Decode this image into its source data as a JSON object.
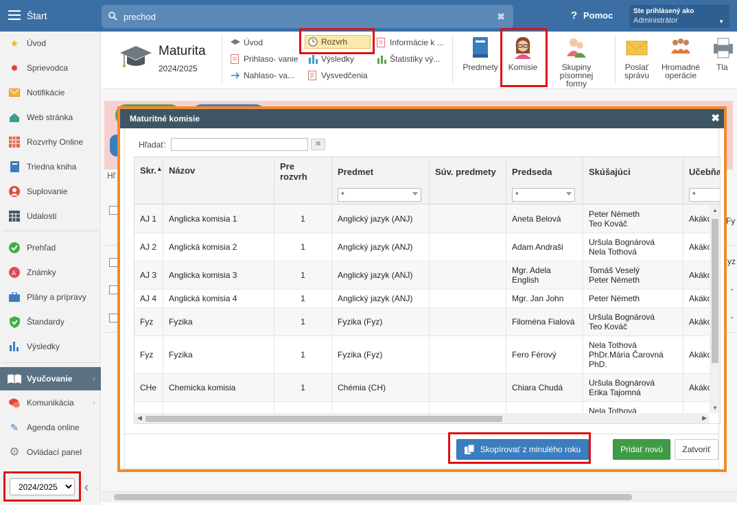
{
  "topbar": {
    "app_title": "Štart",
    "search_value": "prechod",
    "help_label": "Pomoc",
    "user_line1": "Ste prihlásený ako",
    "user_line2": "Administrátor"
  },
  "sidebar": {
    "items": [
      {
        "label": "Úvod",
        "icon": "star-icon"
      },
      {
        "label": "Sprievodca",
        "icon": "wand-icon"
      },
      {
        "label": "Notifikácie",
        "icon": "envelope-icon"
      },
      {
        "label": "Web stránka",
        "icon": "home-icon"
      },
      {
        "label": "Rozvrhy Online",
        "icon": "timetable-icon"
      },
      {
        "label": "Triedna kniha",
        "icon": "book-icon"
      },
      {
        "label": "Suplovanie",
        "icon": "person-icon"
      },
      {
        "label": "Udalosti",
        "icon": "calendar-icon"
      },
      {
        "label": "Prehľad",
        "icon": "check-circle-icon"
      },
      {
        "label": "Známky",
        "icon": "grades-icon"
      },
      {
        "label": "Plány a prípravy",
        "icon": "briefcase-icon"
      },
      {
        "label": "Štandardy",
        "icon": "shield-check-icon"
      },
      {
        "label": "Výsledky",
        "icon": "bar-chart-icon"
      },
      {
        "label": "Vyučovanie",
        "icon": "open-book-icon"
      },
      {
        "label": "Komunikácia",
        "icon": "chat-icon"
      },
      {
        "label": "Agenda online",
        "icon": "pen-icon"
      },
      {
        "label": "Ovládací panel",
        "icon": "gear-icon"
      }
    ],
    "year": "2024/2025"
  },
  "module": {
    "title": "Maturita",
    "year": "2024/2025"
  },
  "ribbon": {
    "uvod": "Úvod",
    "prihlasovanie": "Prihlaso- vanie",
    "nahlasovanie": "Nahlaso- va...",
    "rozvrh": "Rozvrh",
    "vysledky": "Výsledky",
    "vysvedcenia": "Vysvedčenia",
    "informacie": "Informácie k ...",
    "statistiky": "Štatistiky vý...",
    "predmety": "Predmety",
    "komisie": "Komisie",
    "skupiny": "Skupiny písomnej formy",
    "poslat": "Poslať správu",
    "hromadne": "Hromadné operácie",
    "tla": "Tla"
  },
  "background": {
    "hl_label": "Hľ",
    "fy_label": "Fy",
    "yz_label": "yz",
    "dash": "-"
  },
  "dialog": {
    "title": "Maturitné komisie",
    "filter_label": "Hľadať:",
    "filter_value": "",
    "columns": [
      "Skr.",
      "Názov",
      "Pre rozvrh",
      "Predmet",
      "Súv. predmety",
      "Predseda",
      "Skúšajúci",
      "Učebňa"
    ],
    "sort_indicator": "▲",
    "filter_star": "*",
    "rows": [
      [
        "AJ 1",
        "Anglicka komisia 1",
        "1",
        "Anglický jazyk (ANJ)",
        "",
        "Aneta Belová",
        "Peter Németh\nTeo Kováč",
        "Akákoľ"
      ],
      [
        "AJ 2",
        "Anglická komisia 2",
        "1",
        "Anglický jazyk (ANJ)",
        "",
        "Adam Andraši",
        "Uršula Bognárová\nNela Tothová",
        "Akákoľ"
      ],
      [
        "AJ 3",
        "Anglicka komisia 3",
        "1",
        "Anglický jazyk (ANJ)",
        "",
        "Mgr. Adela\nEnglish",
        "Tomáš Veselý\nPeter Németh",
        "Akákoľ"
      ],
      [
        "AJ 4",
        "Anglická komisia 4",
        "1",
        "Anglický jazyk (ANJ)",
        "",
        "Mgr. Jan John",
        "Peter Németh",
        "Akákoľ"
      ],
      [
        "Fyz",
        "Fyzika",
        "1",
        "Fyzika (Fyz)",
        "",
        "Filoména Fialová",
        "Uršula Bognárová\nTeo Kováč",
        "Akákoľ"
      ],
      [
        "Fyz",
        "Fyzika",
        "1",
        "Fyzika (Fyz)",
        "",
        "Fero Férový",
        "Nela Tothová\nPhDr.Mária Čarovná\nPhD.",
        "Akákoľ"
      ],
      [
        "CHe",
        "Chemicka komisia",
        "1",
        "Chémia (CH)",
        "",
        "Chiara Chudá",
        "Uršula Bognárová\nErika Tajomná",
        "Akákoľ"
      ],
      [
        "",
        "",
        "",
        "",
        "",
        "",
        "Nela Tothová",
        ""
      ]
    ],
    "copy_button": "Skopírovať z minulého roku",
    "add_button": "Pridať novú",
    "close_button": "Zatvoriť"
  }
}
